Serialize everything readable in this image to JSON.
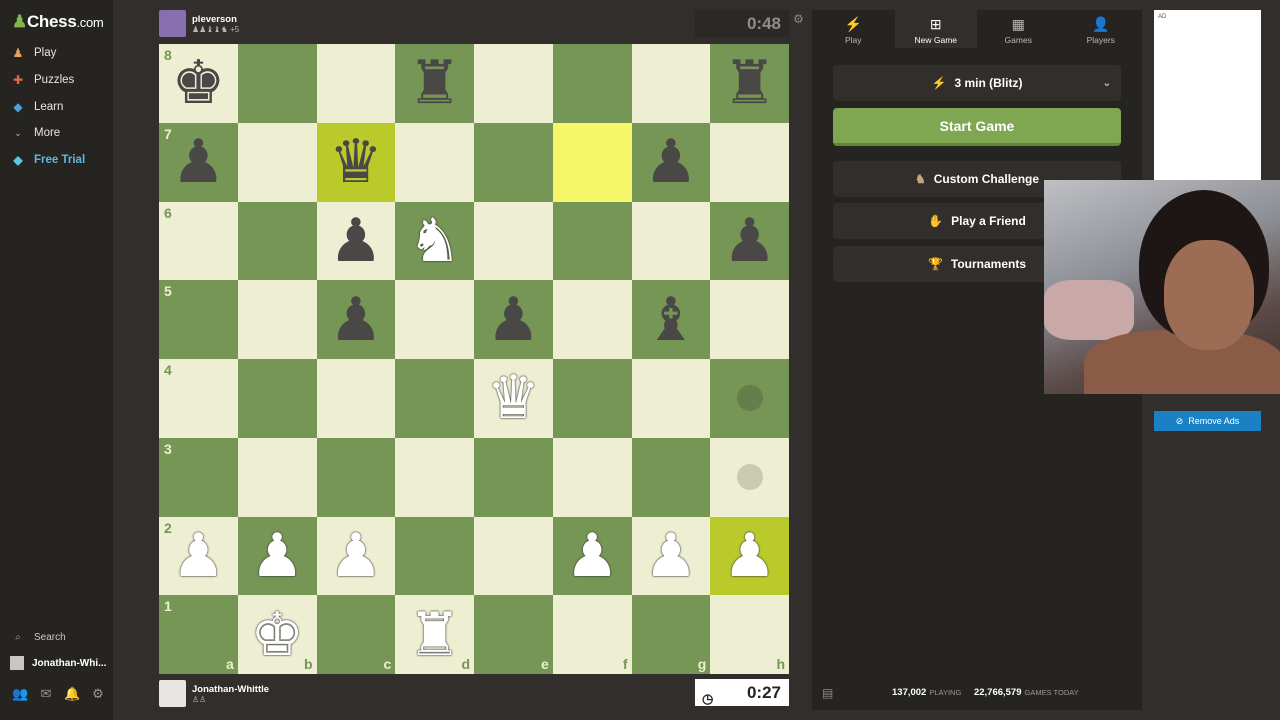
{
  "nav": {
    "logo_text": "Chess",
    "logo_suffix": ".com",
    "items": [
      {
        "label": "Play",
        "icon": "play-pawn-icon"
      },
      {
        "label": "Puzzles",
        "icon": "puzzle-icon"
      },
      {
        "label": "Learn",
        "icon": "learn-cap-icon"
      },
      {
        "label": "More",
        "icon": "chevron-down-icon"
      },
      {
        "label": "Free Trial",
        "icon": "diamond-icon"
      }
    ],
    "search_label": "Search",
    "user_label": "Jonathan-Whi..."
  },
  "opponent": {
    "name": "pleverson",
    "captured": "♟♟♝♝♞ +5"
  },
  "me": {
    "name": "Jonathan-Whittle",
    "captured": "♙♙"
  },
  "clocks": {
    "opponent": "0:48",
    "me": "0:27"
  },
  "board": {
    "files": [
      "a",
      "b",
      "c",
      "d",
      "e",
      "f",
      "g",
      "h"
    ],
    "ranks": [
      "8",
      "7",
      "6",
      "5",
      "4",
      "3",
      "2",
      "1"
    ],
    "pieces": {
      "a8": "bk",
      "d8": "br",
      "h8": "br",
      "a7": "bp",
      "c7": "bq",
      "g7": "bp",
      "c6": "bp",
      "d6": "wn",
      "h6": "bp",
      "c5": "bp",
      "e5": "bp",
      "g5": "bb",
      "e4": "wq",
      "a2": "wp",
      "b2": "wp",
      "c2": "wp",
      "f2": "wp",
      "g2": "wp",
      "h2": "wp",
      "b1": "wk",
      "d1": "wr"
    },
    "highlight": [
      "c7",
      "f7",
      "h2"
    ],
    "move_hints": [
      "h4",
      "h3"
    ]
  },
  "panel": {
    "tabs": [
      {
        "label": "Play",
        "icon": "bolt-icon"
      },
      {
        "label": "New Game",
        "icon": "plus-square-icon",
        "active": true
      },
      {
        "label": "Games",
        "icon": "board-icon"
      },
      {
        "label": "Players",
        "icon": "players-icon"
      }
    ],
    "time_control": "3 min (Blitz)",
    "start_label": "Start Game",
    "custom_label": "Custom Challenge",
    "friend_label": "Play a Friend",
    "tournaments_label": "Tournaments",
    "playing_count": "137,002",
    "playing_label": "PLAYING",
    "games_count": "22,766,579",
    "games_label": "GAMES TODAY"
  },
  "ad": {
    "label": "AD",
    "remove_label": "Remove Ads"
  }
}
